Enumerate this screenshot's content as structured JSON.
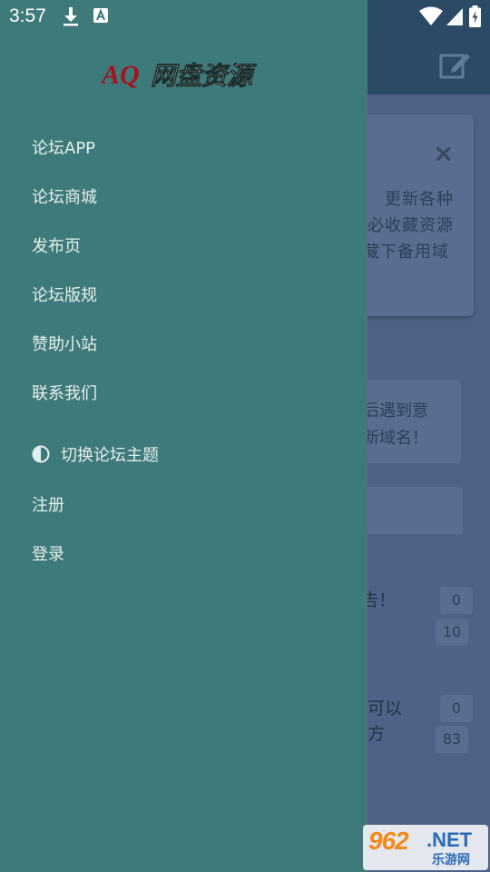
{
  "status_bar": {
    "time": "3:57",
    "icons": [
      "download-icon",
      "a-icon",
      "wifi-icon",
      "signal-icon",
      "battery-icon"
    ]
  },
  "drawer": {
    "logo_text": "AQ网盘资源",
    "menu": [
      {
        "label": "论坛APP"
      },
      {
        "label": "论坛商城"
      },
      {
        "label": "发布页"
      },
      {
        "label": "论坛版规"
      },
      {
        "label": "赞助小站"
      },
      {
        "label": "联系我们"
      }
    ],
    "theme_toggle": {
      "label": "切换论坛主题",
      "icon": "half-circle-icon"
    },
    "register_label": "注册",
    "login_label": "登录",
    "colors": {
      "background": "#3f7a7a",
      "text": "#e3efef"
    }
  },
  "background": {
    "toolbar_icon": "edit-icon",
    "notice_close": "×",
    "notice_lines": [
      "更新各种",
      "必收藏资源",
      "藏下备用域"
    ],
    "info_lines": [
      "后遇到意",
      "新域名！"
    ],
    "threads": [
      {
        "title_lines": [
          "告！"
        ],
        "counts": [
          "0",
          "10"
        ]
      },
      {
        "title_lines": [
          "可以",
          "方"
        ],
        "counts": [
          "0",
          "83"
        ]
      }
    ]
  },
  "watermark": {
    "number": "962",
    "suffix": ".NET",
    "site_name": "乐游网"
  }
}
